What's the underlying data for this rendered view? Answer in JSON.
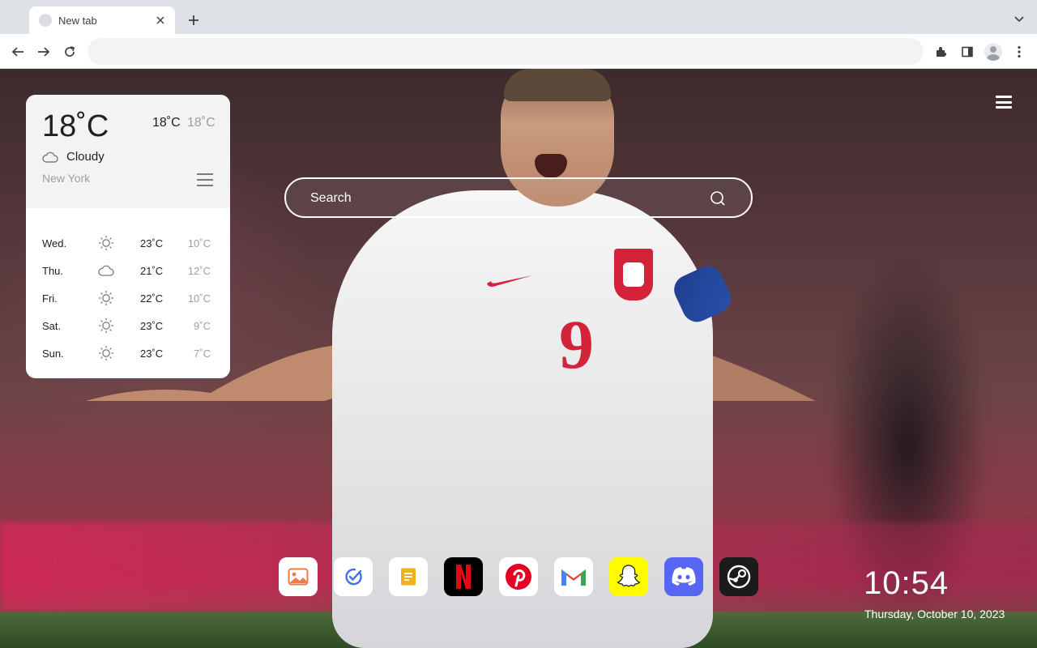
{
  "browser": {
    "tab": {
      "title": "New tab",
      "close_icon": "close-icon"
    },
    "new_tab_icon": "plus-icon",
    "omnibox": {
      "value": "",
      "placeholder": ""
    },
    "toolbar_icons": [
      "back-icon",
      "forward-icon",
      "reload-icon",
      "extensions-icon",
      "side-panel-icon",
      "profile-icon",
      "more-icon"
    ]
  },
  "search": {
    "placeholder": "Search"
  },
  "weather": {
    "current_temp": "18˚C",
    "high": "18˚C",
    "low": "18˚C",
    "condition": "Cloudy",
    "city": "New York",
    "forecast": [
      {
        "day": "Wed.",
        "icon": "sun-icon",
        "high": "23˚C",
        "low": "10˚C"
      },
      {
        "day": "Thu.",
        "icon": "cloud-icon",
        "high": "21˚C",
        "low": "12˚C"
      },
      {
        "day": "Fri.",
        "icon": "sun-icon",
        "high": "22˚C",
        "low": "10˚C"
      },
      {
        "day": "Sat.",
        "icon": "sun-icon",
        "high": "23˚C",
        "low": "9˚C"
      },
      {
        "day": "Sun.",
        "icon": "sun-icon",
        "high": "23˚C",
        "low": "7˚C"
      }
    ]
  },
  "dock": {
    "apps": [
      {
        "name": "gallery",
        "icon": "image-icon",
        "bg": "#ffffff",
        "color": "#f07b4a"
      },
      {
        "name": "tasks",
        "icon": "check-icon",
        "bg": "#ffffff",
        "color": "#3d6fe8"
      },
      {
        "name": "notes",
        "icon": "note-icon",
        "bg": "#ffffff",
        "color": "#f2b01e"
      },
      {
        "name": "netflix",
        "icon": "netflix-icon",
        "bg": "#000000",
        "color": "#e50914"
      },
      {
        "name": "pinterest",
        "icon": "pinterest-icon",
        "bg": "#ffffff",
        "color": "#e60023"
      },
      {
        "name": "gmail",
        "icon": "gmail-icon",
        "bg": "#ffffff",
        "color": "#ea4335"
      },
      {
        "name": "snapchat",
        "icon": "snapchat-icon",
        "bg": "#fffc00",
        "color": "#ffffff"
      },
      {
        "name": "discord",
        "icon": "discord-icon",
        "bg": "#5865f2",
        "color": "#ffffff"
      },
      {
        "name": "steam",
        "icon": "steam-icon",
        "bg": "#1b1b1b",
        "color": "#ffffff"
      }
    ]
  },
  "clock": {
    "time": "10:54",
    "date": "Thursday, October 10, 2023"
  },
  "colors": {
    "chrome": "#dee1e6",
    "card": "#ffffff",
    "muted": "#9aa0a6"
  }
}
